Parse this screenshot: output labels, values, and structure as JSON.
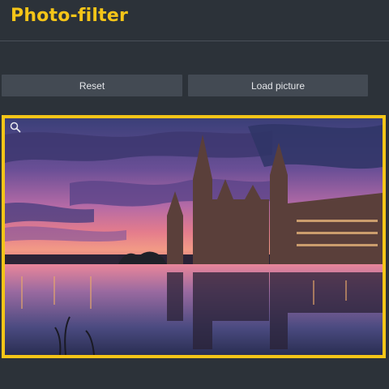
{
  "app": {
    "title": "Photo-filter"
  },
  "toolbar": {
    "reset_label": "Reset",
    "load_label": "Load picture"
  },
  "picture": {
    "zoom_icon": "magnifier-icon"
  },
  "colors": {
    "accent": "#f5c518",
    "background": "#2c3239",
    "button": "#434a53",
    "button_text": "#e4e6e9"
  }
}
